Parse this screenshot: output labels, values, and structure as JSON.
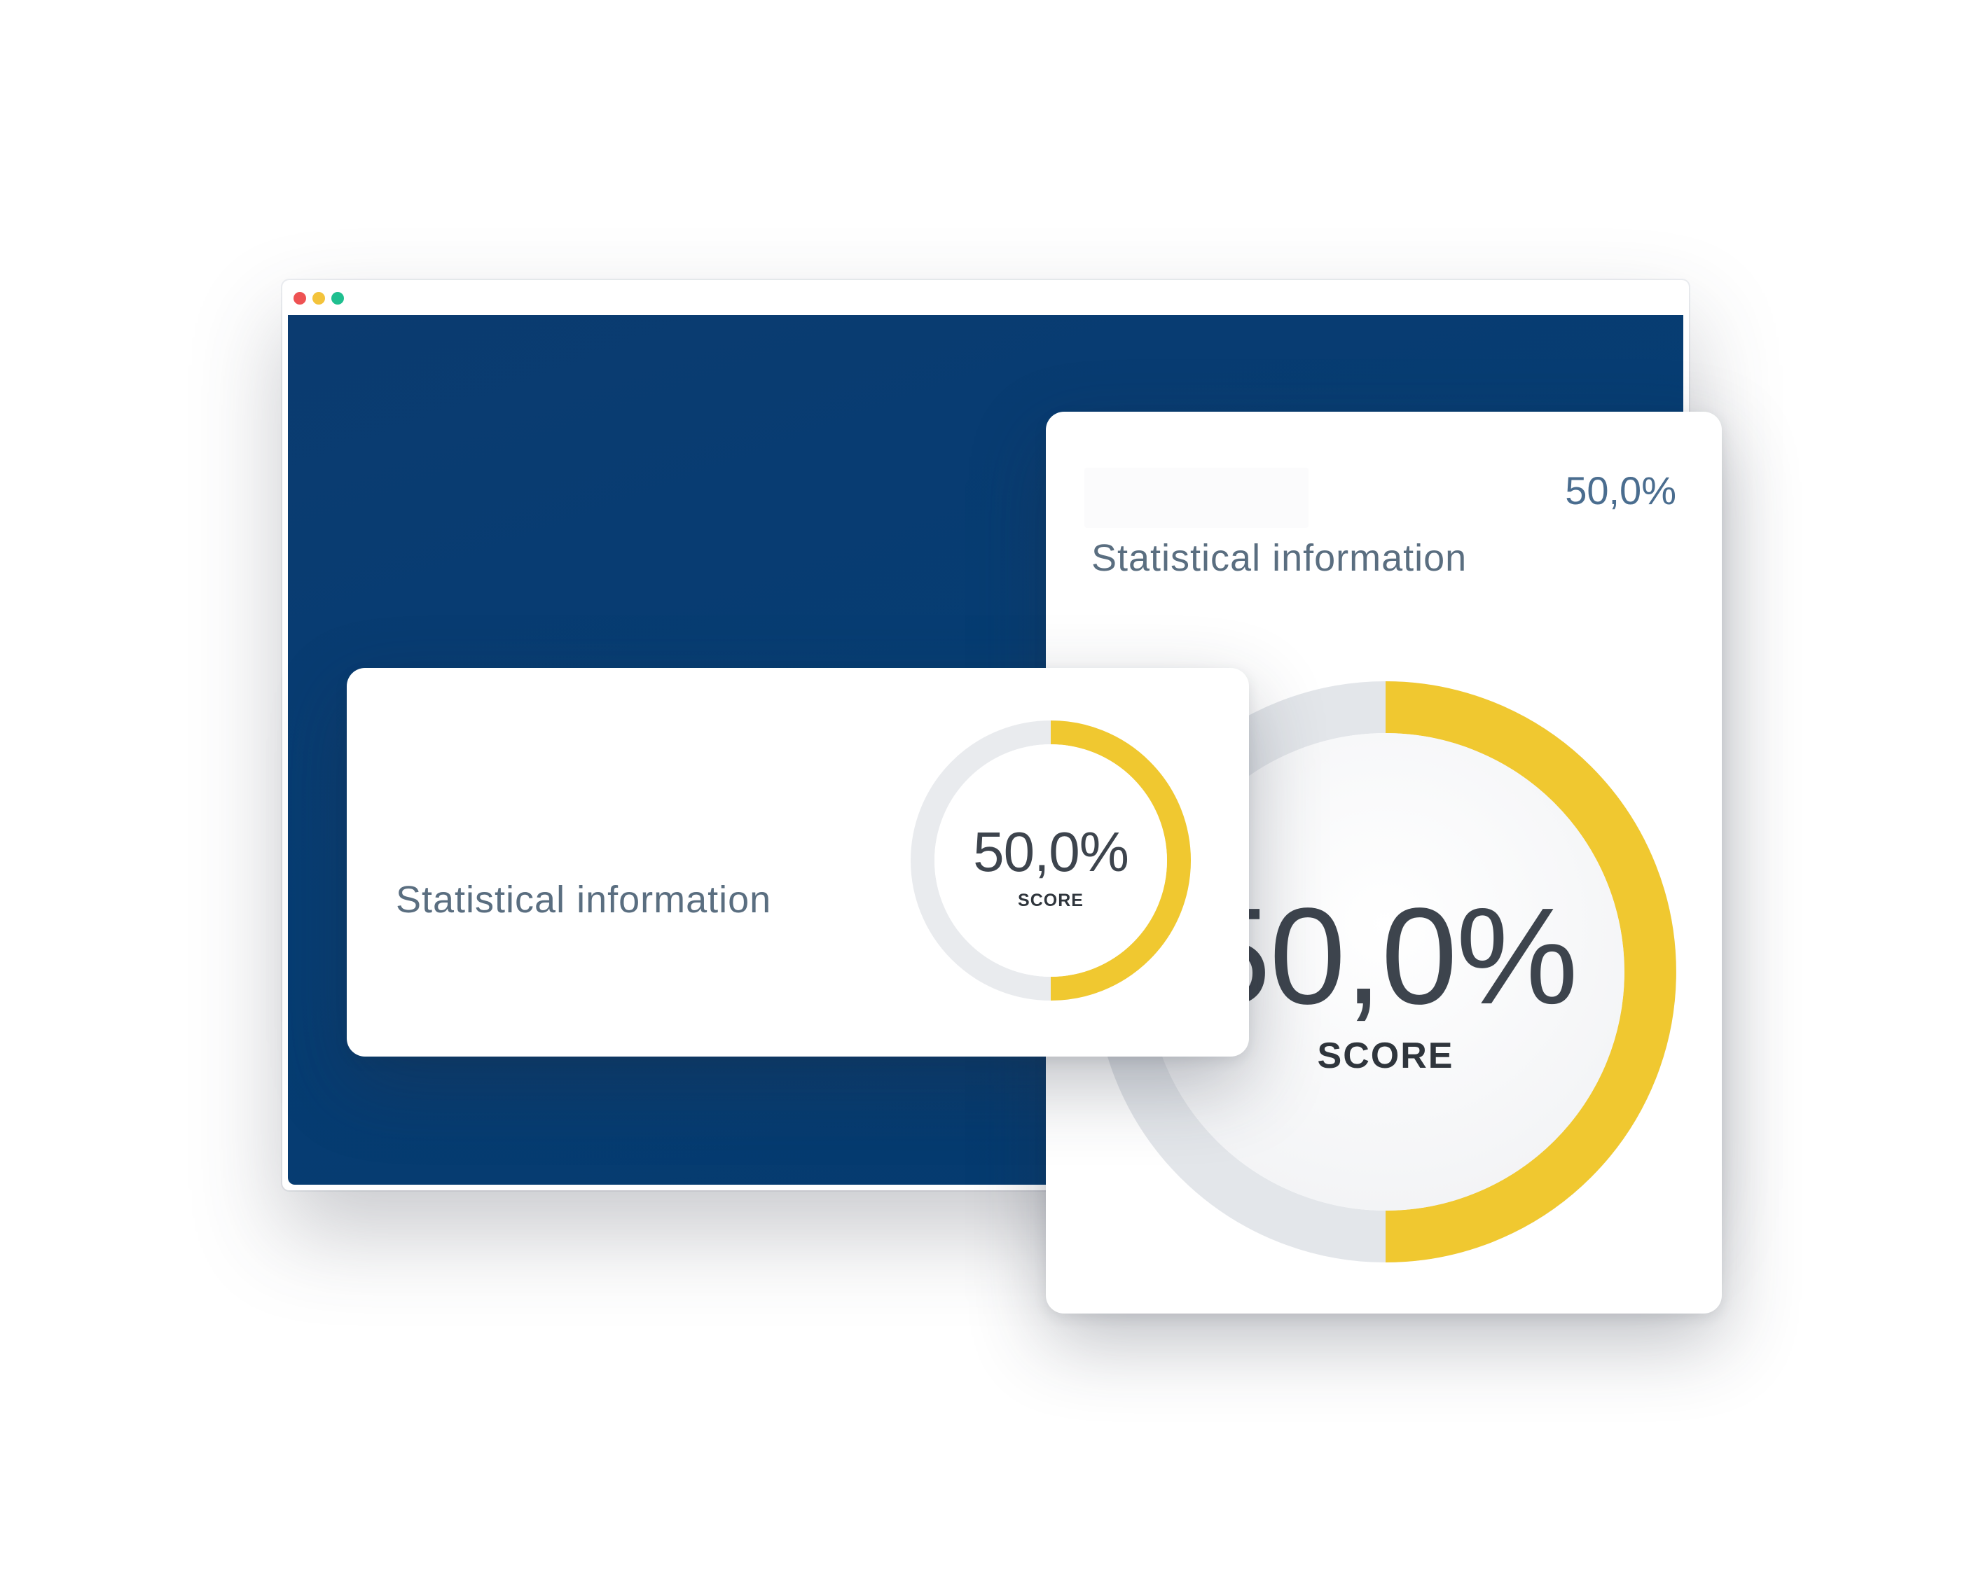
{
  "window": {
    "controls": [
      "close-dot",
      "minimize-dot",
      "maximize-dot"
    ],
    "colors": {
      "close": "#ee5253",
      "minimize": "#f3c33b",
      "maximize": "#1fbf8f",
      "viewport": "#053a6e"
    }
  },
  "large_card": {
    "percent": "50,0%",
    "title": "Statistical information",
    "gauge": {
      "value_text": "50,0%",
      "label": "SCORE",
      "fraction": 0.5
    }
  },
  "small_card": {
    "title": "Statistical information",
    "gauge": {
      "value_text": "50,0%",
      "label": "SCORE",
      "fraction": 0.5
    }
  },
  "colors": {
    "gauge_fill": "#f0c830",
    "gauge_track": "#e3e6ea",
    "title_text": "#5a6e80",
    "percent_text": "#4a6d8f"
  }
}
